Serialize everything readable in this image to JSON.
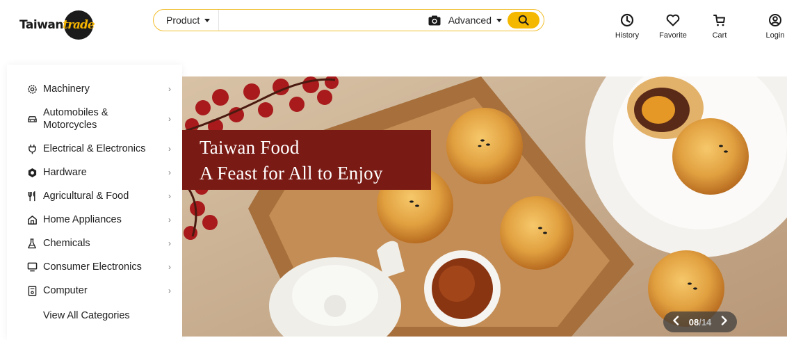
{
  "logo": {
    "word": "Taiwan",
    "badge": "trade"
  },
  "search": {
    "type_label": "Product",
    "placeholder": "",
    "value": "",
    "advanced_label": "Advanced"
  },
  "nav": {
    "history": "History",
    "favorite": "Favorite",
    "cart": "Cart",
    "login": "Login"
  },
  "categories": [
    {
      "label": "Machinery",
      "icon": "gear-icon"
    },
    {
      "label": "Automobiles & Motorcycles",
      "icon": "car-icon"
    },
    {
      "label": "Electrical & Electronics",
      "icon": "plug-icon"
    },
    {
      "label": "Hardware",
      "icon": "bolt-nut-icon"
    },
    {
      "label": "Agricultural & Food",
      "icon": "utensils-icon"
    },
    {
      "label": "Home Appliances",
      "icon": "home-icon"
    },
    {
      "label": "Chemicals",
      "icon": "flask-icon"
    },
    {
      "label": "Consumer Electronics",
      "icon": "monitor-icon"
    },
    {
      "label": "Computer",
      "icon": "computer-case-icon"
    }
  ],
  "view_all": "View All Categories",
  "banner": {
    "line1": "Taiwan Food",
    "line2": "A Feast for All to Enjoy",
    "current": "08",
    "separator": "/",
    "total": "14"
  },
  "colors": {
    "accent": "#f5b800",
    "headline_bg": "#7a1a14"
  }
}
